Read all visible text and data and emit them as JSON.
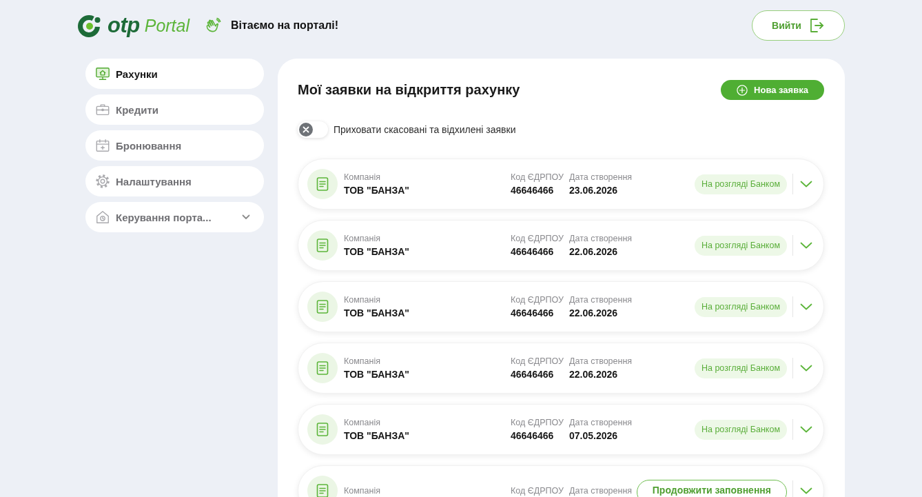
{
  "header": {
    "logo": {
      "brand": "otp",
      "product": "Portal"
    },
    "greeting": "Вітаємо на порталі!",
    "logout_button": "Вийти"
  },
  "sidebar": {
    "items": [
      {
        "label": "Рахунки",
        "kind": "link",
        "selected": true
      },
      {
        "label": "Кредити",
        "kind": "link",
        "selected": false
      },
      {
        "label": "Бронювання",
        "kind": "link",
        "selected": false
      },
      {
        "label": "Налаштування",
        "kind": "link",
        "selected": false
      },
      {
        "label": "Керування порта...",
        "kind": "group",
        "selected": false,
        "expanded": false
      }
    ]
  },
  "main": {
    "title": "Мої заявки на відкриття рахунку",
    "new_button": "Нова заявка",
    "filter_toggle": {
      "label": "Приховати скасовані та відхилені заявки",
      "on": false
    },
    "requests": [
      {
        "company_label": "Компанія",
        "company": "ТОВ \"БАНЗА\"",
        "code_label": "Код ЄДРПОУ",
        "code": "46646466",
        "date_label": "Дата створення",
        "date": "23.06.2026",
        "status": {
          "kind": "badge",
          "label": "На розгляді Банком"
        },
        "expanded": false
      },
      {
        "company_label": "Компанія",
        "company": "ТОВ \"БАНЗА\"",
        "code_label": "Код ЄДРПОУ",
        "code": "46646466",
        "date_label": "Дата створення",
        "date": "22.06.2026",
        "status": {
          "kind": "badge",
          "label": "На розгляді Банком"
        },
        "expanded": false
      },
      {
        "company_label": "Компанія",
        "company": "ТОВ \"БАНЗА\"",
        "code_label": "Код ЄДРПОУ",
        "code": "46646466",
        "date_label": "Дата створення",
        "date": "22.06.2026",
        "status": {
          "kind": "badge",
          "label": "На розгляді Банком"
        },
        "expanded": false
      },
      {
        "company_label": "Компанія",
        "company": "ТОВ \"БАНЗА\"",
        "code_label": "Код ЄДРПОУ",
        "code": "46646466",
        "date_label": "Дата створення",
        "date": "22.06.2026",
        "status": {
          "kind": "badge",
          "label": "На розгляді Банком"
        },
        "expanded": false
      },
      {
        "company_label": "Компанія",
        "company": "ТОВ \"БАНЗА\"",
        "code_label": "Код ЄДРПОУ",
        "code": "46646466",
        "date_label": "Дата створення",
        "date": "07.05.2026",
        "status": {
          "kind": "badge",
          "label": "На розгляді Банком"
        },
        "expanded": false
      },
      {
        "company_label": "Компанія",
        "code_label": "Код ЄДРПОУ",
        "date_label": "Дата створення",
        "status": {
          "kind": "button",
          "label": "Продовжити заповнення"
        },
        "expanded": false
      }
    ]
  }
}
